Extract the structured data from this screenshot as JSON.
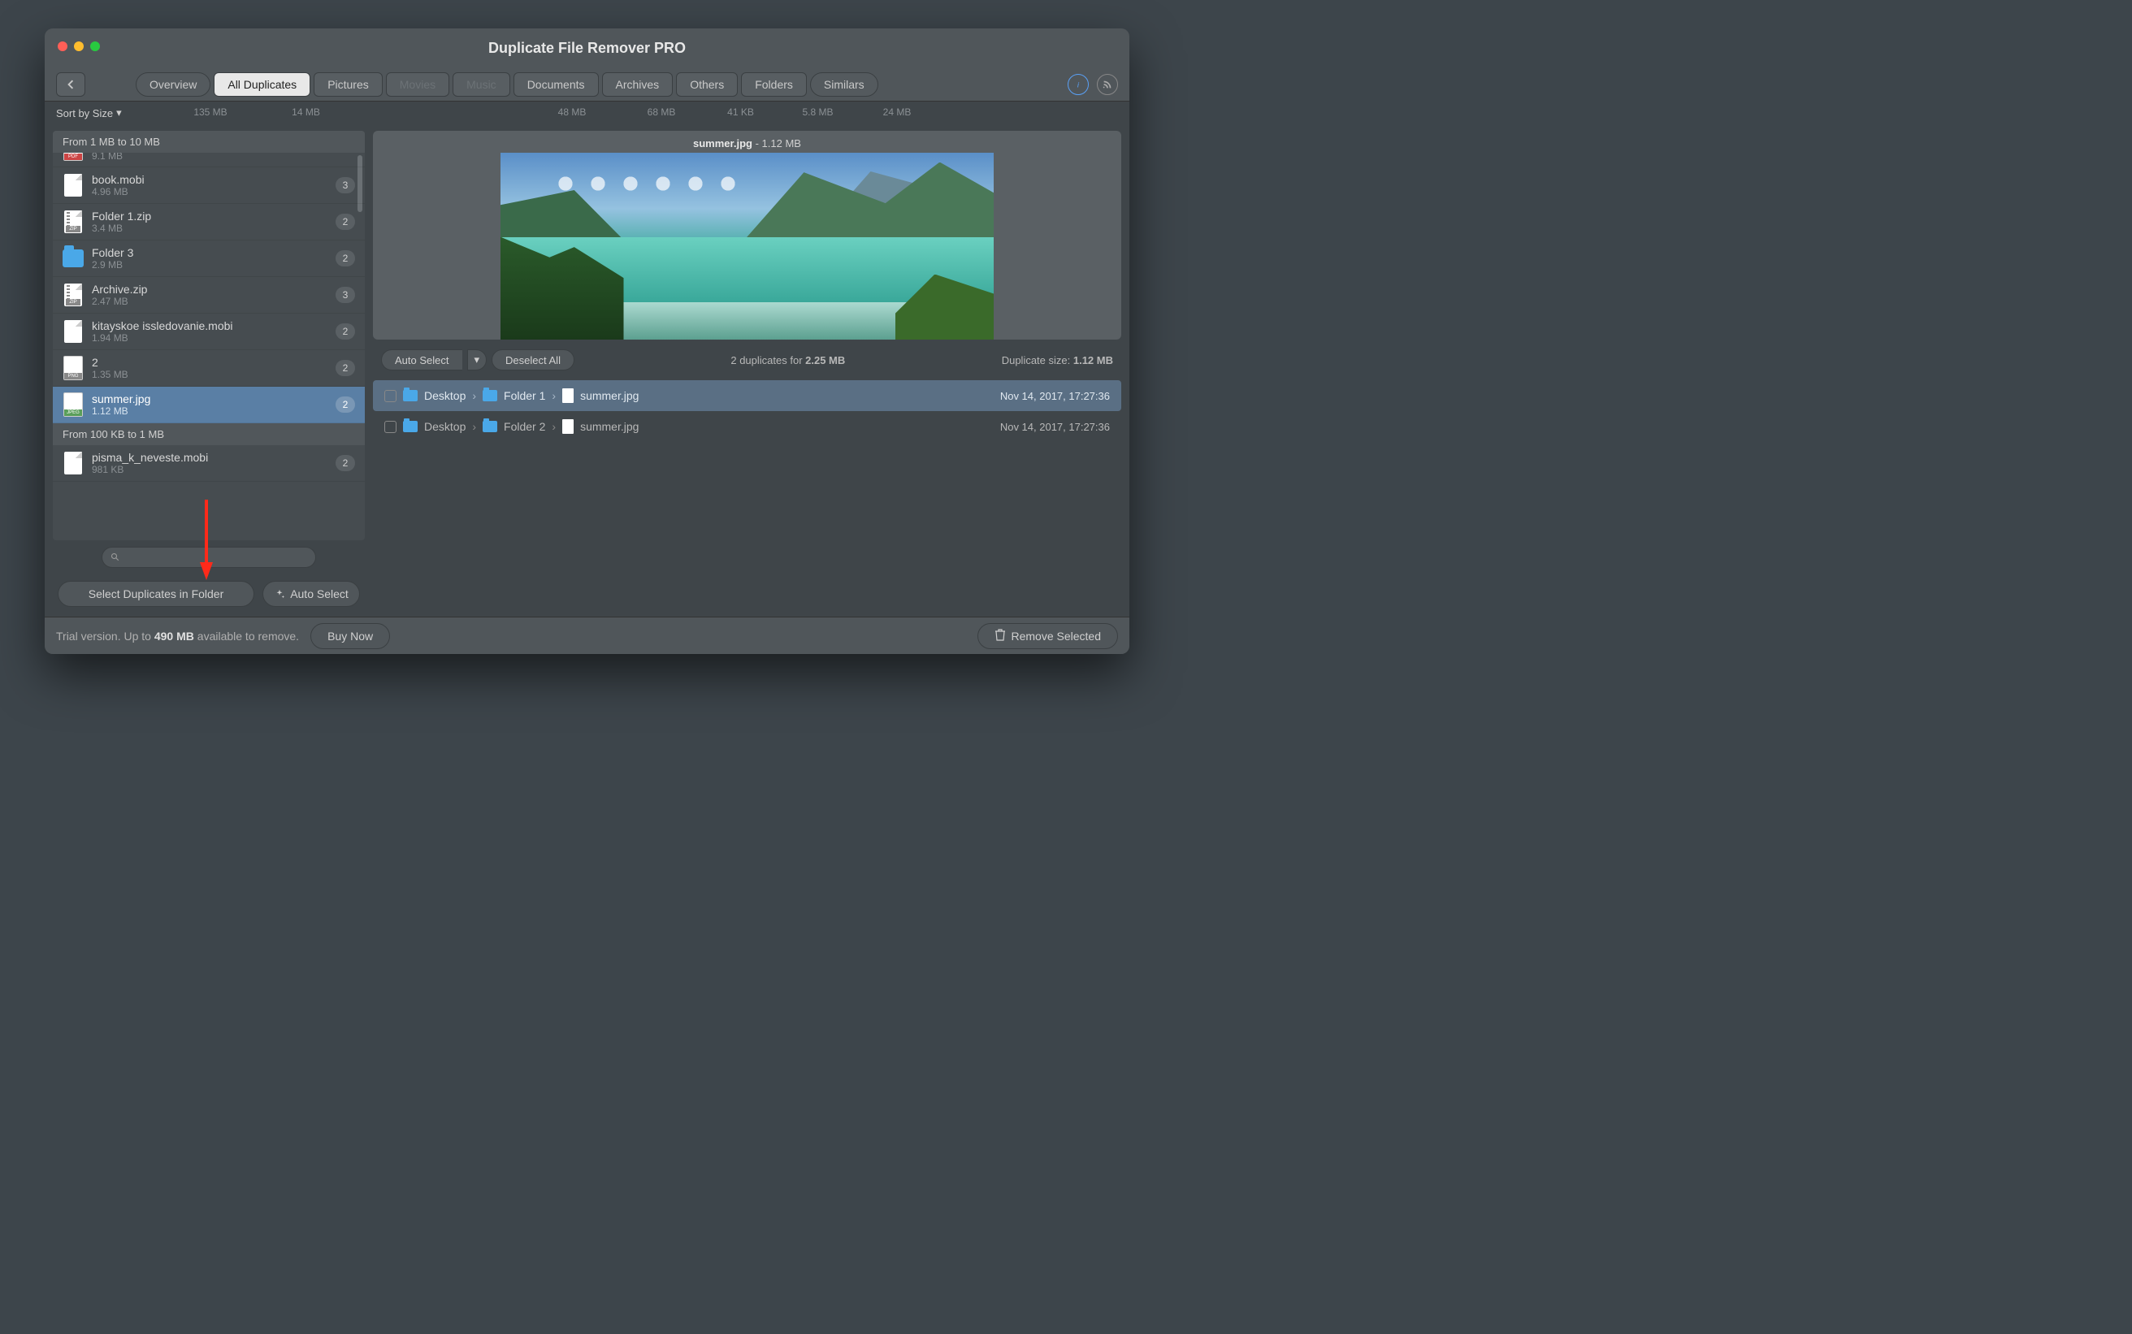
{
  "title": "Duplicate File Remover PRO",
  "tabs": {
    "overview": "Overview",
    "all": "All Duplicates",
    "pictures": "Pictures",
    "movies": "Movies",
    "music": "Music",
    "documents": "Documents",
    "archives": "Archives",
    "others": "Others",
    "folders": "Folders",
    "similars": "Similars"
  },
  "tab_sizes": [
    "135 MB",
    "14 MB",
    "",
    "",
    "48 MB",
    "68 MB",
    "41 KB",
    "5.8 MB",
    "24 MB"
  ],
  "sort_label": "Sort by Size",
  "list": {
    "sections": [
      {
        "title": "From 1 MB to 10 MB",
        "items": [
          {
            "name": "",
            "size": "9.1 MB",
            "count": "",
            "icon": "pdf",
            "partial": true
          },
          {
            "name": "book.mobi",
            "size": "4.96 MB",
            "count": "3",
            "icon": "doc"
          },
          {
            "name": "Folder 1.zip",
            "size": "3.4 MB",
            "count": "2",
            "icon": "zip"
          },
          {
            "name": "Folder 3",
            "size": "2.9 MB",
            "count": "2",
            "icon": "folder"
          },
          {
            "name": "Archive.zip",
            "size": "2.47 MB",
            "count": "3",
            "icon": "zip"
          },
          {
            "name": "kitayskoe issledovanie.mobi",
            "size": "1.94 MB",
            "count": "2",
            "icon": "doc"
          },
          {
            "name": "2",
            "size": "1.35 MB",
            "count": "2",
            "icon": "png"
          },
          {
            "name": "summer.jpg",
            "size": "1.12 MB",
            "count": "2",
            "icon": "jpeg",
            "selected": true
          }
        ]
      },
      {
        "title": "From 100 KB to 1 MB",
        "items": [
          {
            "name": "pisma_k_neveste.mobi",
            "size": "981 KB",
            "count": "2",
            "icon": "doc"
          }
        ]
      }
    ]
  },
  "side_buttons": {
    "select_in_folder": "Select Duplicates in Folder",
    "auto_select": "Auto Select"
  },
  "preview": {
    "name": "summer.jpg",
    "size": "1.12 MB"
  },
  "controls": {
    "auto_select": "Auto Select",
    "deselect": "Deselect All",
    "summary_pre": "2 duplicates for ",
    "summary_bold": "2.25 MB",
    "dup_size_pre": "Duplicate size: ",
    "dup_size_bold": "1.12 MB"
  },
  "dups": [
    {
      "path": [
        "Desktop",
        "Folder 1",
        "summer.jpg"
      ],
      "date": "Nov 14, 2017, 17:27:36",
      "sel": true
    },
    {
      "path": [
        "Desktop",
        "Folder 2",
        "summer.jpg"
      ],
      "date": "Nov 14, 2017, 17:27:36"
    }
  ],
  "footer": {
    "trial_pre": "Trial version. Up to ",
    "trial_bold": "490 MB",
    "trial_post": " available to remove.",
    "buy": "Buy Now",
    "remove": "Remove Selected"
  }
}
